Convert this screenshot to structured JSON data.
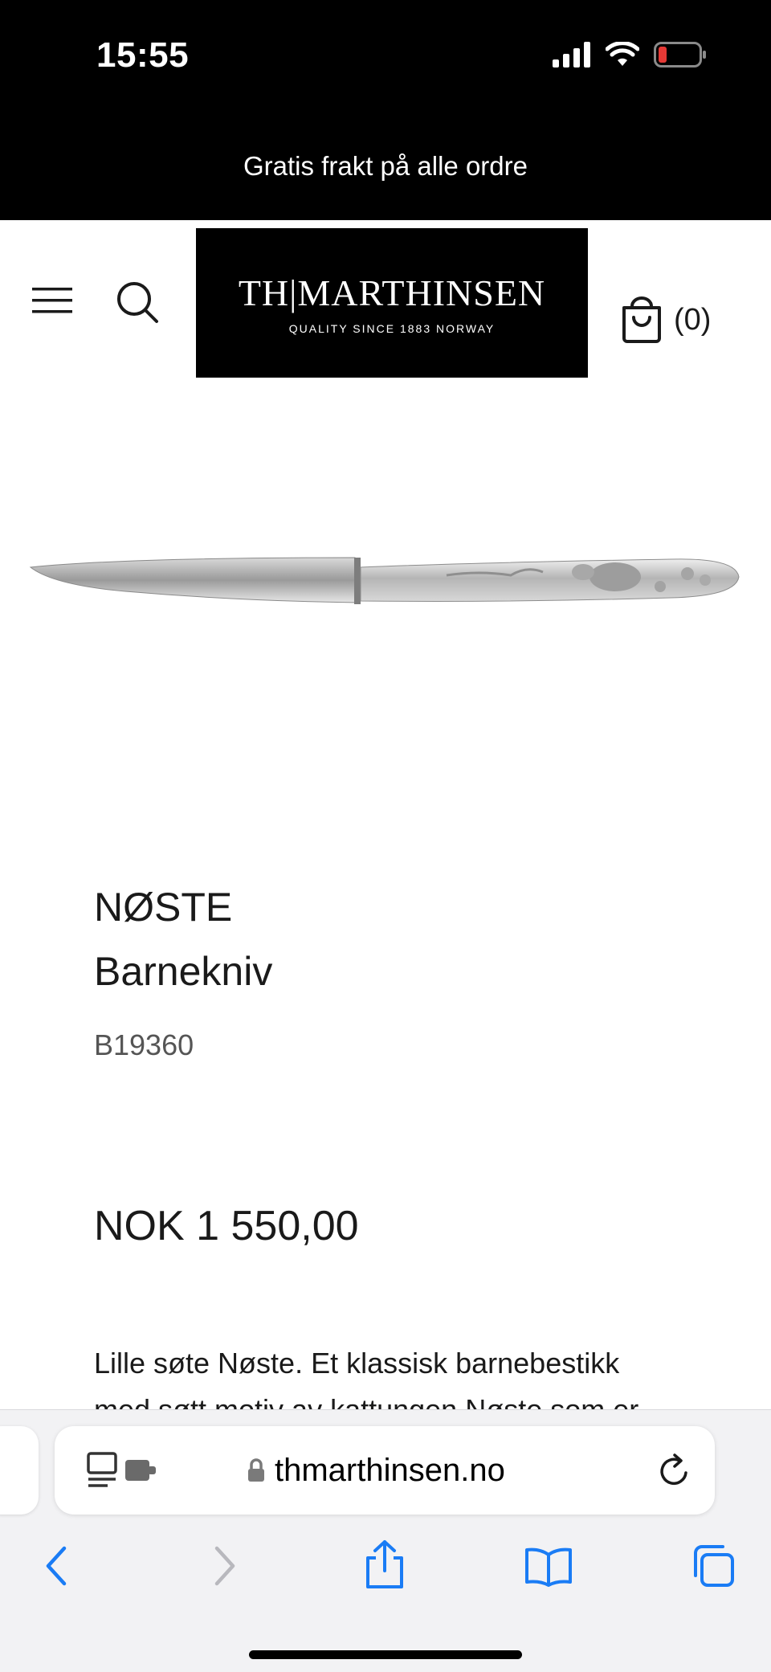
{
  "status_bar": {
    "time": "15:55",
    "icons": [
      "signal-icon",
      "wifi-icon",
      "battery-icon"
    ],
    "battery_color": "#e53935"
  },
  "promo": {
    "text": "Gratis frakt på alle ordre"
  },
  "header": {
    "logo": {
      "main": "TH|MARTHINSEN",
      "sub": "QUALITY SINCE 1883   NORWAY"
    },
    "cart_count": "(0)",
    "icons": [
      "menu-icon",
      "search-icon",
      "shopping-bag-icon"
    ]
  },
  "product": {
    "brand": "NØSTE",
    "name": "Barnekniv",
    "sku": "B19360",
    "price": "NOK 1 550,00",
    "description": "Lille søte Nøste. Et klassisk barnebestikk med søtt motiv av kattungen Nøste som er"
  },
  "browser": {
    "url": "thmarthinsen.no",
    "icons": [
      "reader-icon",
      "extension-icon",
      "lock-icon",
      "reload-icon",
      "back-icon",
      "forward-icon",
      "share-icon",
      "bookmarks-icon",
      "tabs-icon"
    ],
    "accent_color": "#1a7cf5"
  }
}
